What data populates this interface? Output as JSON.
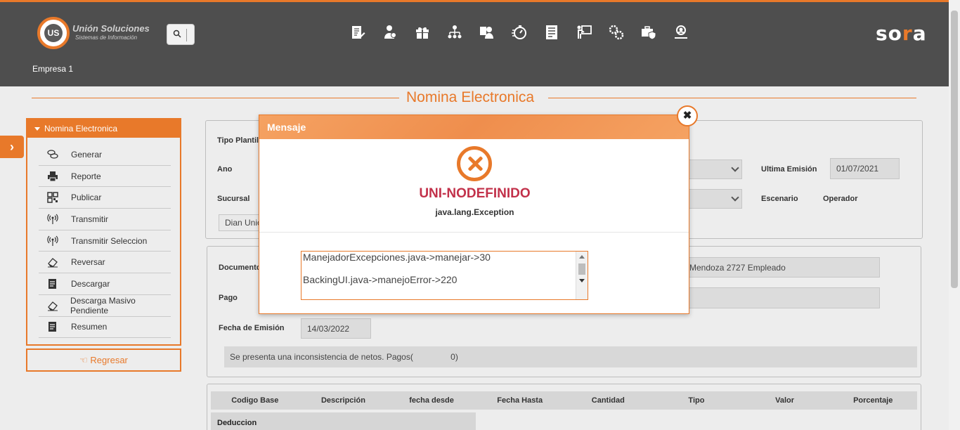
{
  "header": {
    "logo_mark": "US",
    "logo_name": "Unión Soluciones",
    "logo_sub": "Sistemas de Información",
    "brand": "sora",
    "company": "Empresa 1",
    "nav_icons": [
      "form-edit-icon",
      "user-money-icon",
      "gift-icon",
      "org-chart-icon",
      "user-card-icon",
      "stopwatch-icon",
      "document-list-icon",
      "presentation-icon",
      "gears-icon",
      "briefcase-shield-icon",
      "user-search-icon"
    ]
  },
  "page": {
    "title": "Nomina Electronica"
  },
  "sidebar": {
    "title": "Nomina Electronica",
    "items": [
      {
        "label": "Generar",
        "icon": "coins-icon"
      },
      {
        "label": "Reporte",
        "icon": "printer-icon"
      },
      {
        "label": "Publicar",
        "icon": "qr-code-icon"
      },
      {
        "label": "Transmitir",
        "icon": "broadcast-icon"
      },
      {
        "label": "Transmitir Seleccion",
        "icon": "broadcast-icon"
      },
      {
        "label": "Reversar",
        "icon": "eraser-icon"
      },
      {
        "label": "Descargar",
        "icon": "document-icon"
      },
      {
        "label": "Descarga Masivo Pendiente",
        "icon": "eraser-icon"
      },
      {
        "label": "Resumen",
        "icon": "document-icon"
      }
    ],
    "back_label": "Regresar"
  },
  "form": {
    "tipo_plantilla_label": "Tipo Plantil",
    "ano_label": "Ano",
    "sucursal_label": "Sucursal",
    "dian_value": "Dian Union",
    "ultima_emision_label": "Ultima Emisión",
    "ultima_emision_value": "01/07/2021",
    "escenario_label": "Escenario",
    "escenario_value": "Operador"
  },
  "document": {
    "documento_label": "Documento",
    "empleado_value": "Mendoza 2727 Empleado",
    "pago_label": "Pago",
    "fecha_emision_label": "Fecha de Emisión",
    "fecha_emision_value": "14/03/2022",
    "message": "Se presenta una inconsistencia de netos. Pagos(                0)"
  },
  "table": {
    "columns": [
      "Codigo Base",
      "Descripción",
      "fecha desde",
      "Fecha Hasta",
      "Cantidad",
      "Tipo",
      "Valor",
      "Porcentaje"
    ],
    "section": "Deduccion"
  },
  "modal": {
    "title": "Mensaje",
    "error_code": "UNI-NODEFINIDO",
    "exception": "java.lang.Exception",
    "trace": [
      "ManejadorExcepciones.java->manejar->30",
      "BackingUI.java->manejoError->220"
    ]
  },
  "colors": {
    "accent": "#e8792a",
    "header_bg": "#4e4e4e",
    "error_text": "#c2314a"
  }
}
